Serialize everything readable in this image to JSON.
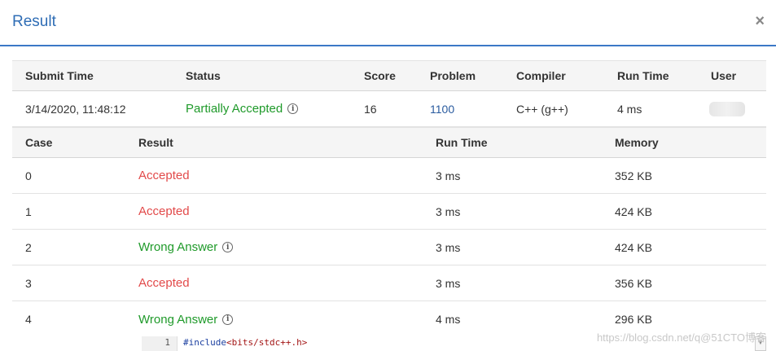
{
  "modal": {
    "title": "Result",
    "close_label": "×"
  },
  "submission": {
    "headers": [
      "Submit Time",
      "Status",
      "Score",
      "Problem",
      "Compiler",
      "Run Time",
      "User"
    ],
    "submit_time": "3/14/2020, 11:48:12",
    "status": "Partially Accepted",
    "score": "16",
    "problem": "1100",
    "compiler": "C++ (g++)",
    "run_time": "4 ms"
  },
  "cases": {
    "headers": [
      "Case",
      "Result",
      "Run Time",
      "Memory"
    ],
    "rows": [
      {
        "case": "0",
        "result": "Accepted",
        "run_time": "3 ms",
        "memory": "352 KB"
      },
      {
        "case": "1",
        "result": "Accepted",
        "run_time": "3 ms",
        "memory": "424 KB"
      },
      {
        "case": "2",
        "result": "Wrong Answer",
        "run_time": "3 ms",
        "memory": "424 KB"
      },
      {
        "case": "3",
        "result": "Accepted",
        "run_time": "3 ms",
        "memory": "356 KB"
      },
      {
        "case": "4",
        "result": "Wrong Answer",
        "run_time": "4 ms",
        "memory": "296 KB"
      }
    ]
  },
  "code": {
    "line_number": "1",
    "directive": "#include",
    "header": "<bits/stdc++.h>"
  },
  "watermark": "https://blog.csdn.net/q@51CTO博客",
  "icons": {
    "info": "info-circle-icon",
    "close": "close-icon",
    "scroll": "scroll-down-arrow-icon"
  },
  "colors": {
    "accent": "#2f6db5",
    "accepted": "#e24a4a",
    "wrong_answer": "#1f9a2a",
    "link": "#2a5b9f"
  }
}
